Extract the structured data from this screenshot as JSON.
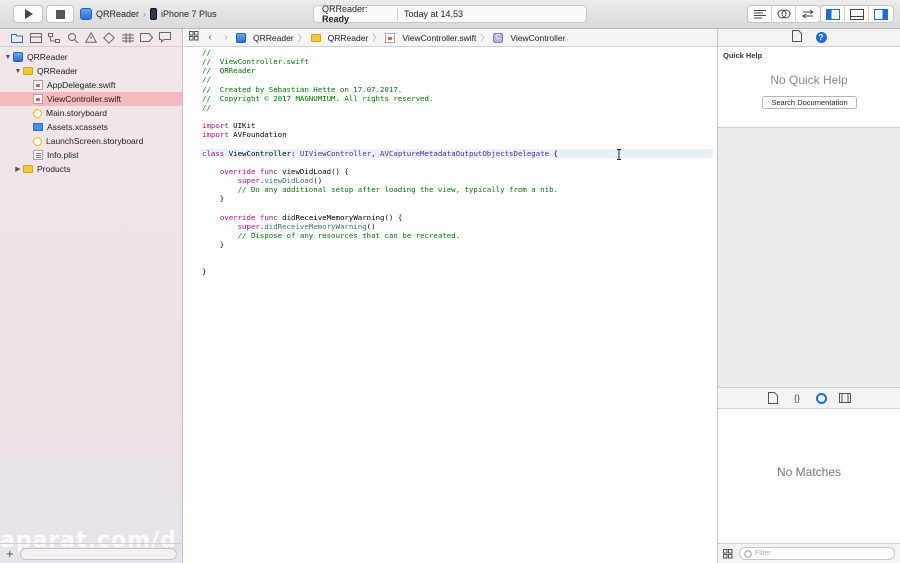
{
  "toolbar": {
    "scheme_target": "QRReader",
    "scheme_device": "iPhone 7 Plus",
    "status_app": "QRReader:",
    "status_state": "Ready",
    "status_time": "Today at 14.53"
  },
  "navigator": {
    "tabs": [
      "project-navigator",
      "source-control",
      "symbol-navigator",
      "find-navigator",
      "issue-navigator",
      "test-navigator",
      "debug-navigator",
      "breakpoint-navigator",
      "report-navigator"
    ],
    "tree": [
      {
        "label": "QRReader",
        "icon": "project-icon",
        "level": 0,
        "expanded": true
      },
      {
        "label": "QRReader",
        "icon": "folder-icon",
        "level": 1,
        "expanded": true
      },
      {
        "label": "AppDelegate.swift",
        "icon": "swift-file-icon",
        "level": 2
      },
      {
        "label": "ViewController.swift",
        "icon": "swift-file-icon",
        "level": 2,
        "selected": true
      },
      {
        "label": "Main.storyboard",
        "icon": "storyboard-icon",
        "level": 2
      },
      {
        "label": "Assets.xcassets",
        "icon": "assets-icon",
        "level": 2
      },
      {
        "label": "LaunchScreen.storyboard",
        "icon": "storyboard-icon",
        "level": 2
      },
      {
        "label": "Info.plist",
        "icon": "plist-icon",
        "level": 2
      },
      {
        "label": "Products",
        "icon": "folder-icon",
        "level": 1,
        "expanded": false
      }
    ],
    "watermark": "aparat.com/d"
  },
  "jumpbar": {
    "crumbs": [
      "QRReader",
      "QRReader",
      "ViewController.swift",
      "ViewController"
    ]
  },
  "editor": {
    "lines": [
      "//",
      "//  ViewController.swift",
      "//  QRReader",
      "//",
      "//  Created by Sebastian Hette on 17.07.2017.",
      "//  Copyright © 2017 MAGNUMIUM. All rights reserved.",
      "//",
      "",
      "import UIKit",
      "import AVFoundation",
      "",
      "class ViewController: UIViewController, AVCaptureMetadataOutputObjectsDelegate {",
      "",
      "    override func viewDidLoad() {",
      "        super.viewDidLoad()",
      "        // Do any additional setup after loading the view, typically from a nib.",
      "    }",
      "",
      "    override func didReceiveMemoryWarning() {",
      "        super.didReceiveMemoryWarning()",
      "        // Dispose of any resources that can be recreated.",
      "    }",
      "",
      "",
      "}"
    ],
    "current_line": 11
  },
  "quick_help": {
    "title": "Quick Help",
    "empty": "No Quick Help",
    "button": "Search Documentation"
  },
  "library": {
    "empty": "No Matches",
    "filter_placeholder": "Filter"
  },
  "colors": {
    "comment": "#007400",
    "keyword": "#aa0d91",
    "type": "#5c2699",
    "selection": "#f6b9bd",
    "accent": "#1f6cd8"
  }
}
